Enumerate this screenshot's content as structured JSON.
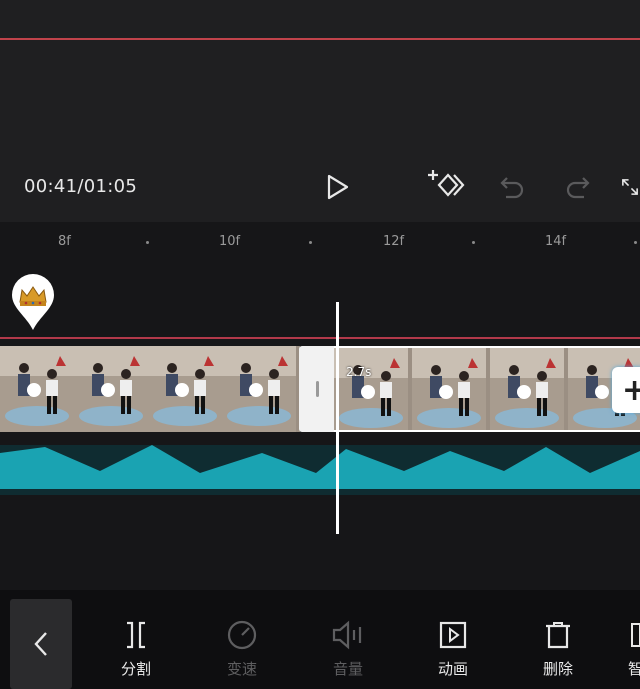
{
  "player": {
    "timecode": "00:41/01:05"
  },
  "ruler": {
    "labels": [
      "8f",
      "10f",
      "12f",
      "14f"
    ]
  },
  "clip": {
    "duration_label": "2.7s"
  },
  "toolbar": {
    "items": [
      {
        "label": "分割",
        "icon": "split-icon",
        "enabled": true
      },
      {
        "label": "变速",
        "icon": "speed-icon",
        "enabled": false
      },
      {
        "label": "音量",
        "icon": "volume-icon",
        "enabled": false
      },
      {
        "label": "动画",
        "icon": "animation-icon",
        "enabled": true
      },
      {
        "label": "删除",
        "icon": "delete-icon",
        "enabled": true
      },
      {
        "label": "智",
        "icon": "smart-icon",
        "enabled": true
      }
    ]
  },
  "colors": {
    "accent_red": "#c0434b",
    "audio_teal": "#1aa3b2",
    "background": "#1b1b1d"
  }
}
